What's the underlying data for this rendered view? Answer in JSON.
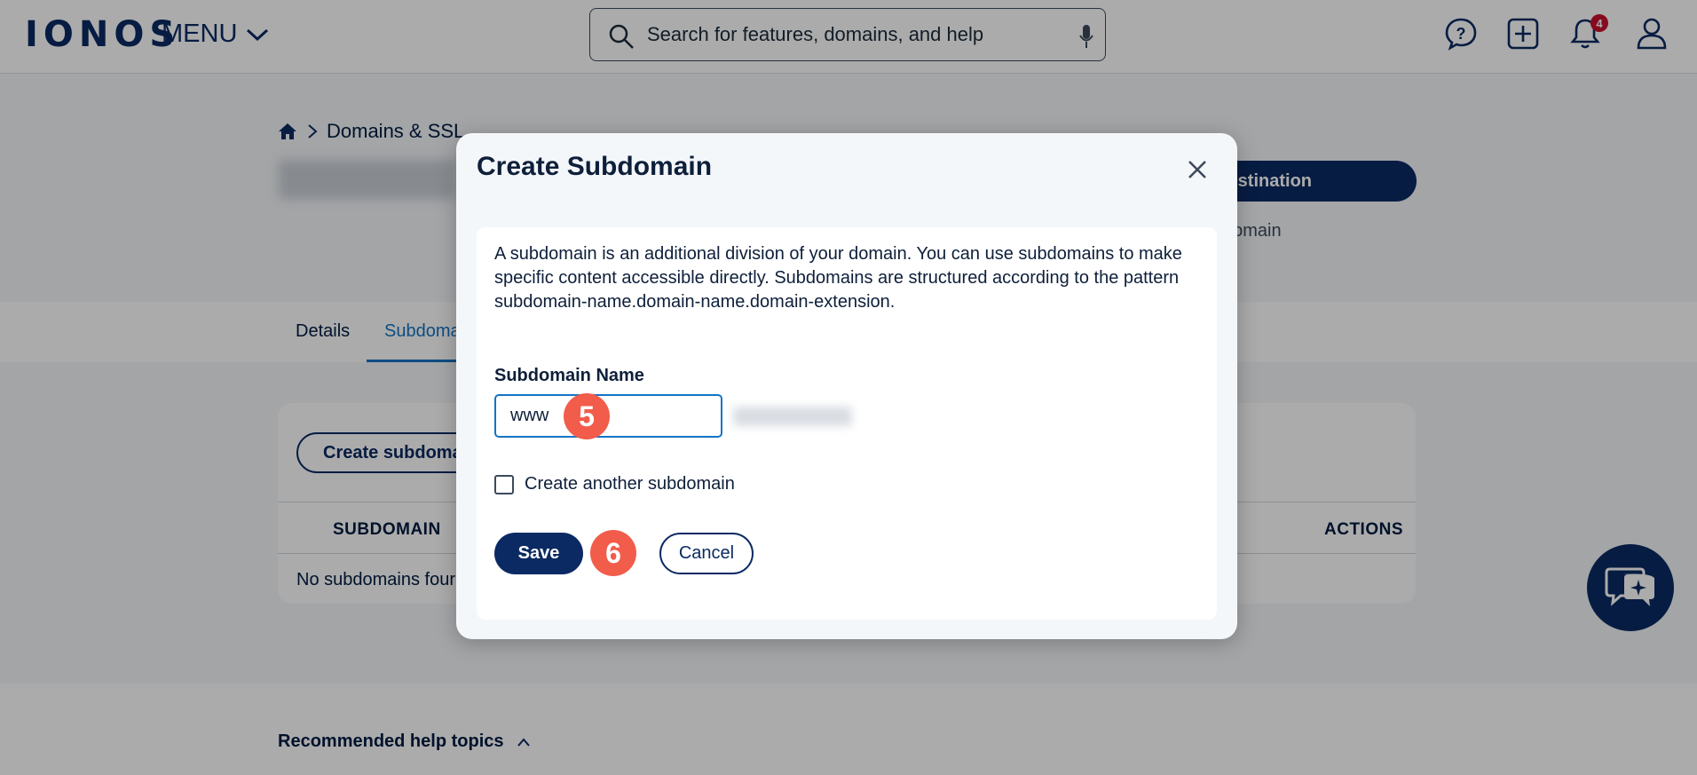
{
  "header": {
    "logo": "IONOS",
    "menu_label": "MENU",
    "search_placeholder": "Search for features, domains, and help",
    "notification_count": "4"
  },
  "page": {
    "breadcrumb": "Domains & SSL",
    "destination_button": "estination",
    "destination_sub": "domain",
    "tabs": [
      "Details",
      "Subdoma"
    ],
    "create_button": "Create subdoma",
    "table_headers": [
      "SUBDOMAIN",
      "ACTIONS"
    ],
    "empty_text": "No subdomains four",
    "help_title": "Recommended help topics"
  },
  "modal": {
    "title": "Create Subdomain",
    "description": "A subdomain is an additional division of your domain. You can use subdomains to make specific content accessible directly. Subdomains are structured according to the pattern subdomain-name.domain-name.domain-extension.",
    "field_label": "Subdomain Name",
    "field_value": "www",
    "checkbox_label": "Create another subdomain",
    "save_label": "Save",
    "cancel_label": "Cancel"
  },
  "markers": [
    "5",
    "6"
  ],
  "colors": {
    "brand": "#0b2a63",
    "accent": "#1474c4",
    "marker": "#f25c4b",
    "badge": "#c8102e"
  }
}
